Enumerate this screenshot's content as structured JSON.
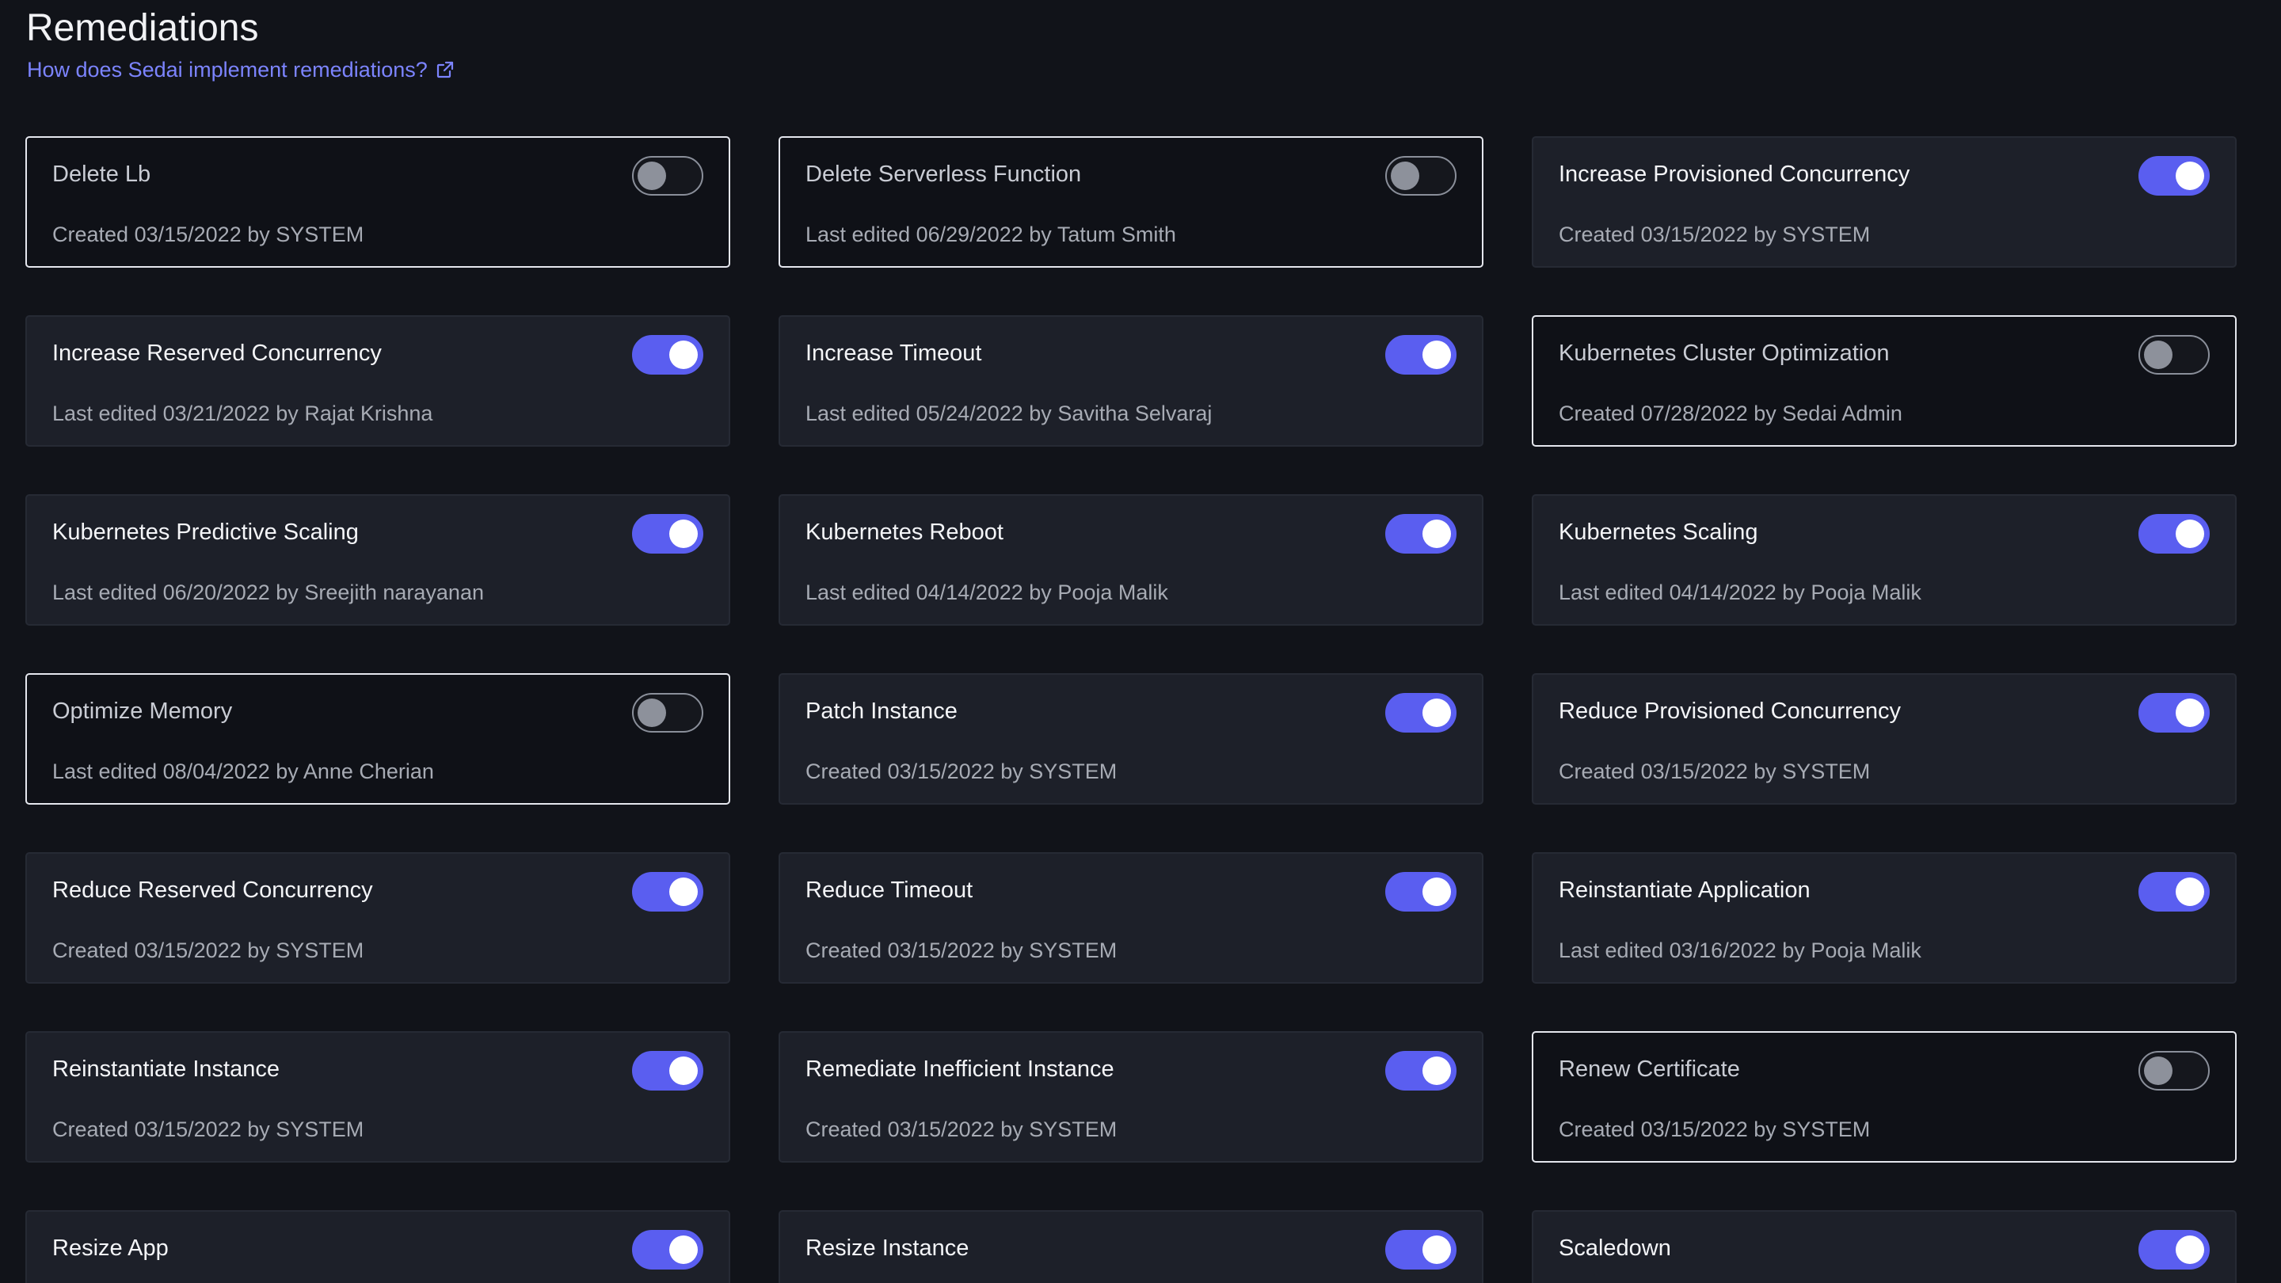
{
  "page": {
    "title": "Remediations",
    "help_link": "How does Sedai implement remediations?"
  },
  "colors": {
    "background": "#111319",
    "card_on": "#1d2029",
    "card_off": "#0f1117",
    "accent": "#5a5ef0",
    "link": "#7c84ff"
  },
  "remediations": [
    {
      "name": "Delete Lb",
      "action": "Created",
      "date": "03/15/2022",
      "by": "by",
      "user": "SYSTEM",
      "enabled": false
    },
    {
      "name": "Delete Serverless Function",
      "action": "Last edited",
      "date": "06/29/2022",
      "by": "by",
      "user": "Tatum Smith",
      "enabled": false
    },
    {
      "name": "Increase Provisioned Concurrency",
      "action": "Created",
      "date": "03/15/2022",
      "by": "by",
      "user": "SYSTEM",
      "enabled": true
    },
    {
      "name": "Increase Reserved Concurrency",
      "action": "Last edited",
      "date": "03/21/2022",
      "by": "by",
      "user": "Rajat Krishna",
      "enabled": true
    },
    {
      "name": "Increase Timeout",
      "action": "Last edited",
      "date": "05/24/2022",
      "by": "by",
      "user": "Savitha Selvaraj",
      "enabled": true
    },
    {
      "name": "Kubernetes Cluster Optimization",
      "action": "Created",
      "date": "07/28/2022",
      "by": "by",
      "user": "Sedai Admin",
      "enabled": false
    },
    {
      "name": "Kubernetes Predictive Scaling",
      "action": "Last edited",
      "date": "06/20/2022",
      "by": "by",
      "user": "Sreejith narayanan",
      "enabled": true
    },
    {
      "name": "Kubernetes Reboot",
      "action": "Last edited",
      "date": "04/14/2022",
      "by": "by",
      "user": "Pooja Malik",
      "enabled": true
    },
    {
      "name": "Kubernetes Scaling",
      "action": "Last edited",
      "date": "04/14/2022",
      "by": "by",
      "user": "Pooja Malik",
      "enabled": true
    },
    {
      "name": "Optimize Memory",
      "action": "Last edited",
      "date": "08/04/2022",
      "by": "by",
      "user": "Anne Cherian",
      "enabled": false
    },
    {
      "name": "Patch Instance",
      "action": "Created",
      "date": "03/15/2022",
      "by": "by",
      "user": "SYSTEM",
      "enabled": true
    },
    {
      "name": "Reduce Provisioned Concurrency",
      "action": "Created",
      "date": "03/15/2022",
      "by": "by",
      "user": "SYSTEM",
      "enabled": true
    },
    {
      "name": "Reduce Reserved Concurrency",
      "action": "Created",
      "date": "03/15/2022",
      "by": "by",
      "user": "SYSTEM",
      "enabled": true
    },
    {
      "name": "Reduce Timeout",
      "action": "Created",
      "date": "03/15/2022",
      "by": "by",
      "user": "SYSTEM",
      "enabled": true
    },
    {
      "name": "Reinstantiate Application",
      "action": "Last edited",
      "date": "03/16/2022",
      "by": "by",
      "user": "Pooja Malik",
      "enabled": true
    },
    {
      "name": "Reinstantiate Instance",
      "action": "Created",
      "date": "03/15/2022",
      "by": "by",
      "user": "SYSTEM",
      "enabled": true
    },
    {
      "name": "Remediate Inefficient Instance",
      "action": "Created",
      "date": "03/15/2022",
      "by": "by",
      "user": "SYSTEM",
      "enabled": true
    },
    {
      "name": "Renew Certificate",
      "action": "Created",
      "date": "03/15/2022",
      "by": "by",
      "user": "SYSTEM",
      "enabled": false
    },
    {
      "name": "Resize App",
      "action": "",
      "date": "",
      "by": "",
      "user": "",
      "enabled": true
    },
    {
      "name": "Resize Instance",
      "action": "",
      "date": "",
      "by": "",
      "user": "",
      "enabled": true
    },
    {
      "name": "Scaledown",
      "action": "",
      "date": "",
      "by": "",
      "user": "",
      "enabled": true
    }
  ]
}
